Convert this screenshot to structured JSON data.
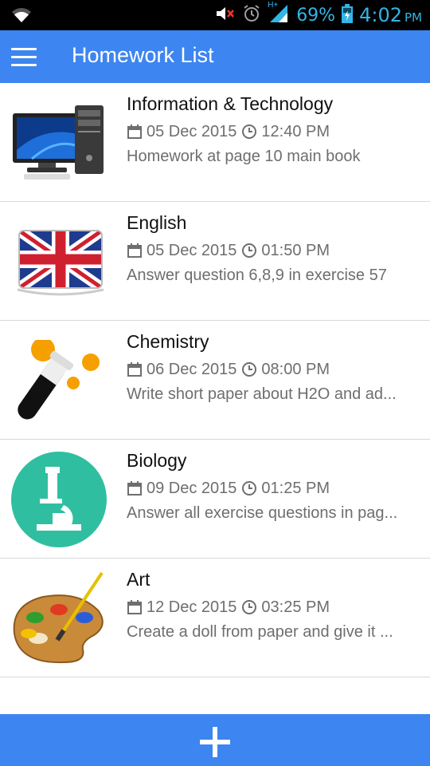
{
  "status_bar": {
    "battery": "69%",
    "time": "4:02",
    "ampm": "PM",
    "network": "H+",
    "accent_color": "#33b5e5"
  },
  "app_bar": {
    "title": "Homework List",
    "menu_icon": "hamburger-menu-icon",
    "color": "#3d85f0"
  },
  "homeworks": [
    {
      "subject": "Information & Technology",
      "date": "05 Dec 2015",
      "time": "12:40 PM",
      "description": "Homework at page 10 main book",
      "icon": "computer-icon"
    },
    {
      "subject": "English",
      "date": "05 Dec 2015",
      "time": "01:50 PM",
      "description": "Answer question 6,8,9 in exercise 57",
      "icon": "uk-flag-icon"
    },
    {
      "subject": "Chemistry",
      "date": "06 Dec 2015",
      "time": "08:00 PM",
      "description": "Write short paper about H2O and ad...",
      "icon": "test-tube-icon"
    },
    {
      "subject": "Biology",
      "date": "09 Dec 2015",
      "time": "01:25 PM",
      "description": "Answer all exercise questions in pag...",
      "icon": "microscope-icon"
    },
    {
      "subject": "Art",
      "date": "12 Dec 2015",
      "time": "03:25 PM",
      "description": "Create a doll from paper and give it ...",
      "icon": "paint-palette-icon"
    }
  ],
  "add_button": {
    "icon": "plus-icon"
  }
}
